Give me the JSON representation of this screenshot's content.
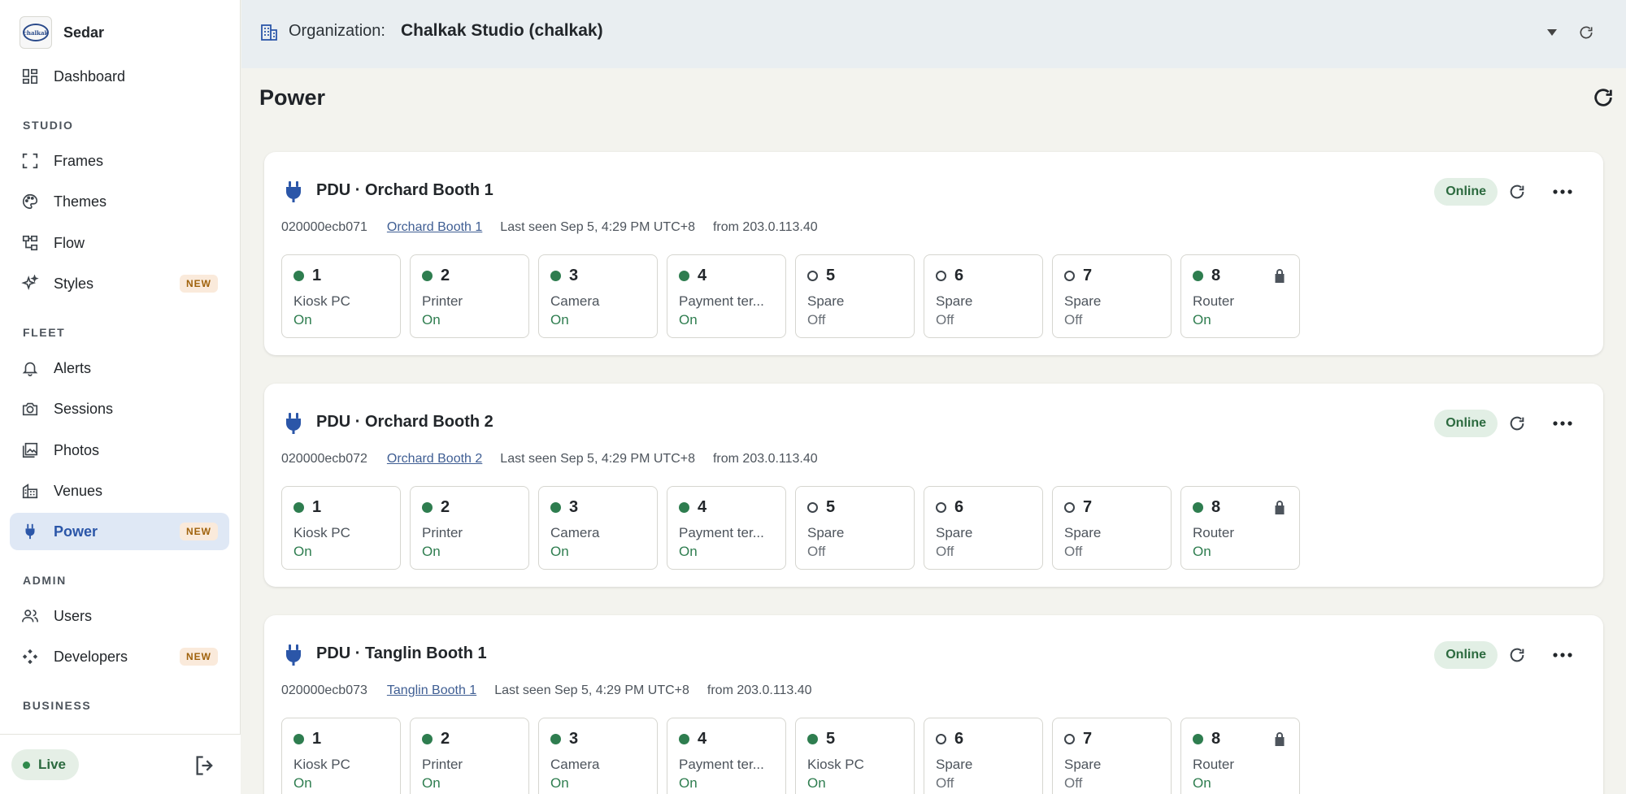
{
  "brand": {
    "name": "Sedar",
    "logo_text": "chalkak"
  },
  "sidebar": {
    "dashboard": "Dashboard",
    "sections": {
      "studio": "STUDIO",
      "fleet": "FLEET",
      "admin": "ADMIN",
      "business": "BUSINESS"
    },
    "items": {
      "frames": "Frames",
      "themes": "Themes",
      "flow": "Flow",
      "styles": "Styles",
      "alerts": "Alerts",
      "sessions": "Sessions",
      "photos": "Photos",
      "venues": "Venues",
      "power": "Power",
      "users": "Users",
      "developers": "Developers"
    },
    "new_badge": "NEW",
    "live_label": "Live"
  },
  "header": {
    "org_label": "Organization:",
    "org_value": "Chalkak Studio (chalkak)"
  },
  "page": {
    "title": "Power"
  },
  "colors": {
    "accent": "#2b56a8",
    "on": "#2e7d4f",
    "online_bg": "#e2efe5"
  },
  "pdus": [
    {
      "title": "PDU · Orchard Booth 1",
      "status": "Online",
      "serial": "020000ecb071",
      "venue_link": "Orchard Booth 1",
      "last_seen": "Last seen Sep 5, 4:29 PM UTC+8",
      "from": "from 203.0.113.40",
      "outlets": [
        {
          "num": "1",
          "name": "Kiosk PC",
          "state": "On"
        },
        {
          "num": "2",
          "name": "Printer",
          "state": "On"
        },
        {
          "num": "3",
          "name": "Camera",
          "state": "On"
        },
        {
          "num": "4",
          "name": "Payment ter...",
          "state": "On"
        },
        {
          "num": "5",
          "name": "Spare",
          "state": "Off"
        },
        {
          "num": "6",
          "name": "Spare",
          "state": "Off"
        },
        {
          "num": "7",
          "name": "Spare",
          "state": "Off"
        },
        {
          "num": "8",
          "name": "Router",
          "state": "On",
          "locked": true
        }
      ]
    },
    {
      "title": "PDU · Orchard Booth 2",
      "status": "Online",
      "serial": "020000ecb072",
      "venue_link": "Orchard Booth 2",
      "last_seen": "Last seen Sep 5, 4:29 PM UTC+8",
      "from": "from 203.0.113.40",
      "outlets": [
        {
          "num": "1",
          "name": "Kiosk PC",
          "state": "On"
        },
        {
          "num": "2",
          "name": "Printer",
          "state": "On"
        },
        {
          "num": "3",
          "name": "Camera",
          "state": "On"
        },
        {
          "num": "4",
          "name": "Payment ter...",
          "state": "On"
        },
        {
          "num": "5",
          "name": "Spare",
          "state": "Off"
        },
        {
          "num": "6",
          "name": "Spare",
          "state": "Off"
        },
        {
          "num": "7",
          "name": "Spare",
          "state": "Off"
        },
        {
          "num": "8",
          "name": "Router",
          "state": "On",
          "locked": true
        }
      ]
    },
    {
      "title": "PDU · Tanglin Booth 1",
      "status": "Online",
      "serial": "020000ecb073",
      "venue_link": "Tanglin Booth 1",
      "last_seen": "Last seen Sep 5, 4:29 PM UTC+8",
      "from": "from 203.0.113.40",
      "outlets": [
        {
          "num": "1",
          "name": "Kiosk PC",
          "state": "On"
        },
        {
          "num": "2",
          "name": "Printer",
          "state": "On"
        },
        {
          "num": "3",
          "name": "Camera",
          "state": "On"
        },
        {
          "num": "4",
          "name": "Payment ter...",
          "state": "On"
        },
        {
          "num": "5",
          "name": "Kiosk PC",
          "state": "On"
        },
        {
          "num": "6",
          "name": "Spare",
          "state": "Off"
        },
        {
          "num": "7",
          "name": "Spare",
          "state": "Off"
        },
        {
          "num": "8",
          "name": "Router",
          "state": "On",
          "locked": true
        }
      ]
    }
  ]
}
